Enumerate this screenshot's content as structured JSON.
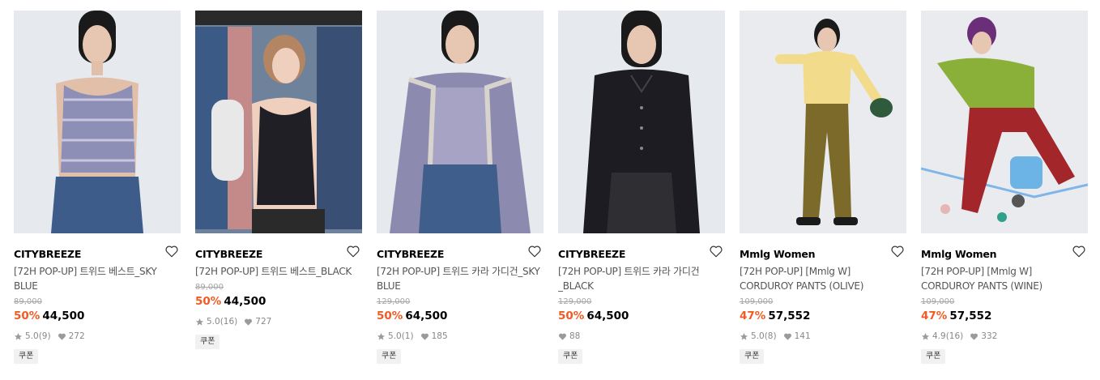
{
  "products": [
    {
      "brand": "CITYBREEZE",
      "name": "[72H POP-UP] 트위드 베스트_SKY BLUE",
      "original_price": "89,000",
      "discount": "50%",
      "price": "44,500",
      "rating": "5.0",
      "reviews": "(9)",
      "likes": "272",
      "coupon": "쿠폰",
      "image": "model in blue tweed vest",
      "bg": "#e6e9ed",
      "top": "#8e8fb7",
      "bottom": "#3d5c8a"
    },
    {
      "brand": "CITYBREEZE",
      "name": "[72H POP-UP] 트위드 베스트_BLACK",
      "original_price": "89,000",
      "discount": "50%",
      "price": "44,500",
      "rating": "5.0",
      "reviews": "(16)",
      "likes": "727",
      "coupon": "쿠폰",
      "image": "model in black tweed vest",
      "bg": "#7a8fa8",
      "top": "#1f1f25",
      "bottom": "#2a2a2a"
    },
    {
      "brand": "CITYBREEZE",
      "name": "[72H POP-UP] 트위드 카라 가디건_SKY BLUE",
      "original_price": "129,000",
      "discount": "50%",
      "price": "64,500",
      "rating": "5.0",
      "reviews": "(1)",
      "likes": "185",
      "coupon": "쿠폰",
      "image": "model in blue tweed cardigan",
      "bg": "#e6e9ed",
      "top": "#8d8ab0",
      "bottom": "#3f5e8c"
    },
    {
      "brand": "CITYBREEZE",
      "name": "[72H POP-UP] 트위드 카라 가디건_BLACK",
      "original_price": "129,000",
      "discount": "50%",
      "price": "64,500",
      "rating": "",
      "reviews": "",
      "likes": "88",
      "coupon": "쿠폰",
      "image": "model in black tweed cardigan",
      "bg": "#e6e9ed",
      "top": "#1c1c22",
      "bottom": "#2e2e33"
    },
    {
      "brand": "Mmlg Women",
      "name": "[72H POP-UP] [Mmlg W] CORDUROY PANTS (OLIVE)",
      "original_price": "109,000",
      "discount": "47%",
      "price": "57,552",
      "rating": "5.0",
      "reviews": "(8)",
      "likes": "141",
      "coupon": "쿠폰",
      "image": "model in yellow hoodie and olive corduroy pants",
      "bg": "#e9ebee",
      "top": "#f2dc8c",
      "bottom": "#7b6a2a"
    },
    {
      "brand": "Mmlg Women",
      "name": "[72H POP-UP] [Mmlg W] CORDUROY PANTS (WINE)",
      "original_price": "109,000",
      "discount": "47%",
      "price": "57,552",
      "rating": "4.9",
      "reviews": "(16)",
      "likes": "332",
      "coupon": "쿠폰",
      "image": "model in green sweater and wine corduroy pants",
      "bg": "#e9ebee",
      "top": "#8bb03a",
      "bottom": "#a3262a"
    }
  ],
  "colors": {
    "discount": "#f15a22",
    "star": "#9a9a9a",
    "heart_small": "#9a9a9a"
  }
}
